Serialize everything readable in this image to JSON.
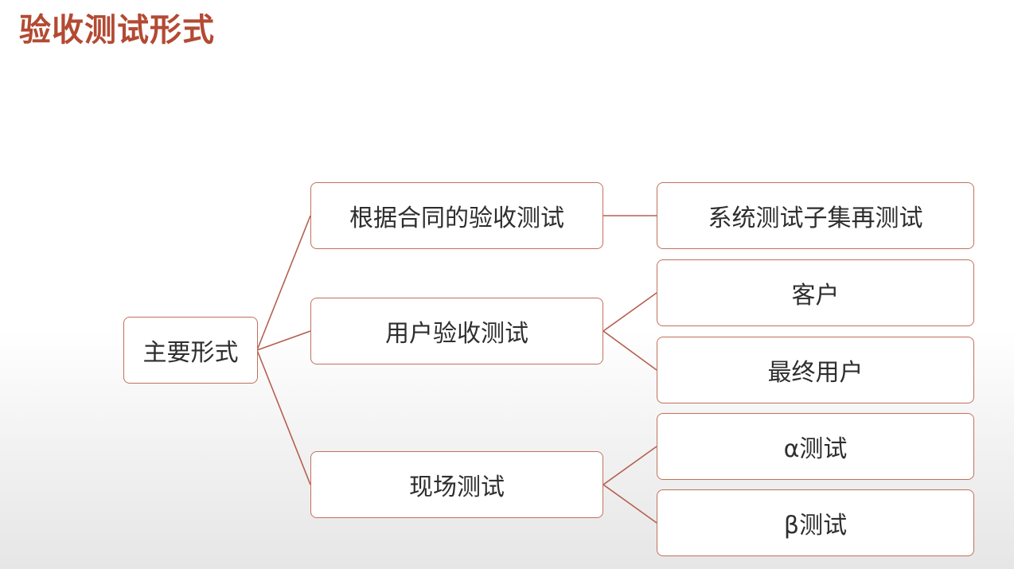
{
  "slide": {
    "title": "验收测试形式"
  },
  "diagram": {
    "root": "主要形式",
    "branches": [
      {
        "label": "根据合同的验收测试",
        "children": [
          "系统测试子集再测试"
        ]
      },
      {
        "label": "用户验收测试",
        "children": [
          "客户",
          "最终用户"
        ]
      },
      {
        "label": "现场测试",
        "children": [
          "α测试",
          "β测试"
        ]
      }
    ]
  },
  "colors": {
    "title": "#b34a33",
    "border": "#c0705c",
    "connector": "#b66050"
  }
}
